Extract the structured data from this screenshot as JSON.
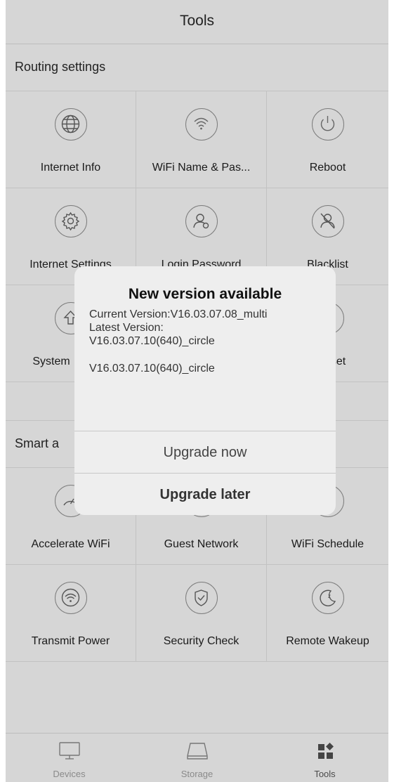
{
  "header": {
    "title": "Tools"
  },
  "sections": [
    {
      "title": "Routing settings",
      "items": [
        {
          "label": "Internet Info",
          "icon": "globe-icon"
        },
        {
          "label": "WiFi Name & Pas...",
          "icon": "wifi-icon"
        },
        {
          "label": "Reboot",
          "icon": "power-icon"
        },
        {
          "label": "Internet Settings",
          "icon": "gear-icon"
        },
        {
          "label": "Login Password",
          "icon": "user-lock-icon"
        },
        {
          "label": "Blacklist",
          "icon": "user-blocked-icon"
        },
        {
          "label": "System",
          "icon": "upgrade-icon"
        },
        {
          "label": "",
          "icon": ""
        },
        {
          "label": "set",
          "icon": "reset-icon"
        }
      ]
    },
    {
      "title": "Smart a",
      "items": [
        {
          "label": "Accelerate WiFi",
          "icon": "speedometer-icon"
        },
        {
          "label": "Guest Network",
          "icon": "guest-icon"
        },
        {
          "label": "WiFi Schedule",
          "icon": "alarm-clock-icon"
        },
        {
          "label": "Transmit Power",
          "icon": "wifi-signal-icon"
        },
        {
          "label": "Security Check",
          "icon": "shield-check-icon"
        },
        {
          "label": "Remote Wakeup",
          "icon": "moon-sleep-icon"
        }
      ]
    }
  ],
  "dialog": {
    "title": "New version available",
    "current_version": "Current Version:V16.03.07.08_multi",
    "latest_version_label": "Latest Version:",
    "latest_version_value": "V16.03.07.10(640)_circle",
    "release_note": "V16.03.07.10(640)_circle",
    "upgrade_now": "Upgrade now",
    "upgrade_later": "Upgrade later"
  },
  "tabbar": {
    "tabs": [
      {
        "label": "Devices",
        "icon": "monitor-icon"
      },
      {
        "label": "Storage",
        "icon": "drive-icon"
      },
      {
        "label": "Tools",
        "icon": "tools-grid-icon",
        "active": true
      }
    ]
  }
}
